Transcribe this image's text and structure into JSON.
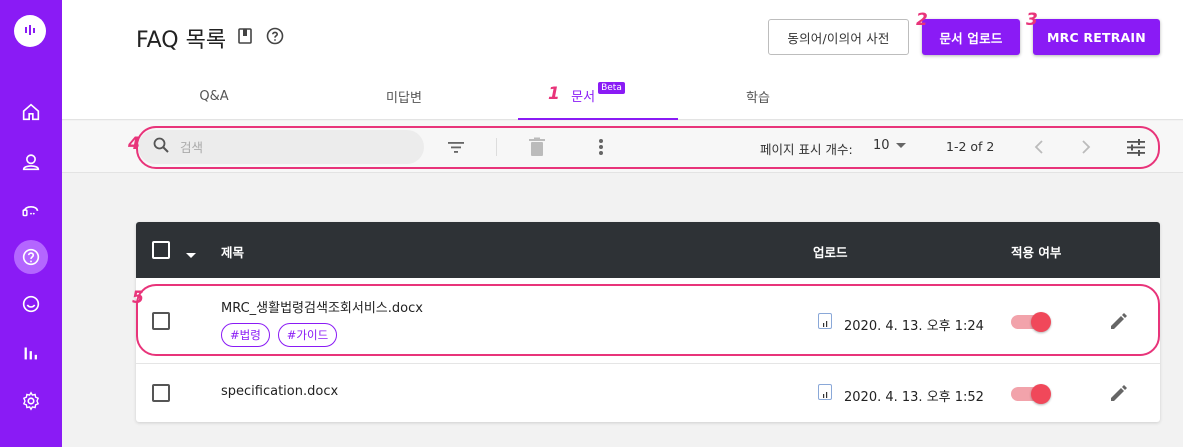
{
  "page": {
    "title": "FAQ 목록"
  },
  "header": {
    "synonym_button": "동의어/이의어 사전",
    "upload_button": "문서 업로드",
    "retrain_button": "MRC RETRAIN"
  },
  "tabs": [
    {
      "label": "Q&A"
    },
    {
      "label": "미답변"
    },
    {
      "label": "문서",
      "badge": "Beta"
    },
    {
      "label": "학습"
    }
  ],
  "toolbar": {
    "search_placeholder": "검색",
    "page_size_label": "페이지 표시 개수:",
    "page_size_value": "10",
    "page_range": "1-2 of 2"
  },
  "table": {
    "columns": {
      "title": "제목",
      "upload": "업로드",
      "applied": "적용 여부"
    },
    "rows": [
      {
        "filename": "MRC_생활법령검색조회서비스.docx",
        "tags": [
          "#법령",
          "#가이드"
        ],
        "date": "2020. 4. 13. 오후 1:24",
        "applied": true
      },
      {
        "filename": "specification.docx",
        "tags": [],
        "date": "2020. 4. 13. 오후 1:52",
        "applied": true
      }
    ]
  },
  "annotations": [
    "1",
    "2",
    "3",
    "4",
    "5"
  ],
  "colors": {
    "brand": "#8a1bf5",
    "annotation": "#e8347a",
    "toggle_on": "#f0485a",
    "table_header": "#2e3236"
  }
}
